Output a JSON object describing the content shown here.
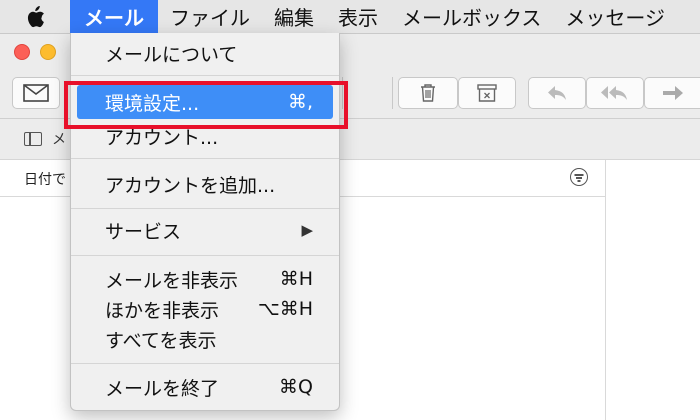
{
  "menubar": {
    "apple_icon": "apple-logo-icon",
    "items": [
      {
        "label": "メール",
        "active": true
      },
      {
        "label": "ファイル"
      },
      {
        "label": "編集"
      },
      {
        "label": "表示"
      },
      {
        "label": "メールボックス"
      },
      {
        "label": "メッセージ"
      }
    ]
  },
  "mail_menu": {
    "about": "メールについて",
    "preferences": "環境設定...",
    "preferences_shortcut": "⌘,",
    "accounts": "アカウント...",
    "add_account": "アカウントを追加...",
    "services": "サービス",
    "services_arrow": "▶",
    "hide_mail": "メールを非表示",
    "hide_mail_shortcut": "⌘H",
    "hide_others": "ほかを非表示",
    "hide_others_shortcut": "⌥⌘H",
    "show_all": "すべてを表示",
    "quit": "メールを終了",
    "quit_shortcut": "⌘Q"
  },
  "window": {
    "mailbox_label_stub": "メ",
    "sort_label": "日付で"
  },
  "colors": {
    "menubar_active": "#3478f6",
    "menu_highlight": "#3e8ef7",
    "callout_box": "#e8102a"
  }
}
